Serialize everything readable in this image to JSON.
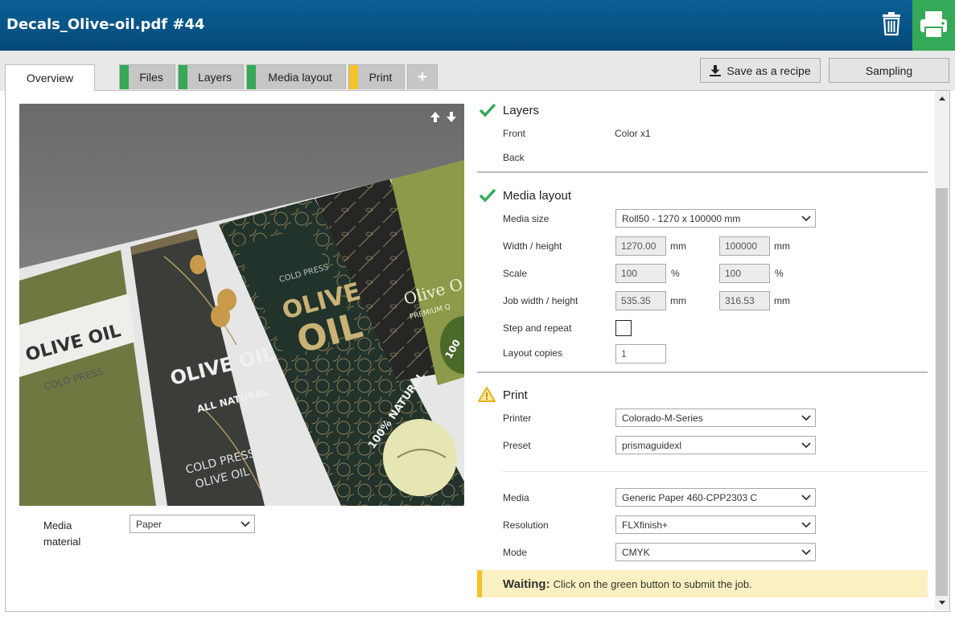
{
  "window": {
    "title": "Decals_Olive-oil.pdf #44"
  },
  "colors": {
    "header": "#0a5f96",
    "print_button": "#35a957",
    "marker_ok": "#35a957",
    "marker_warn": "#f5c228",
    "tab_bg": "#c6c6c6",
    "waiting_bg": "#fbf0c1"
  },
  "tabs": [
    {
      "label": "Overview",
      "status": "active"
    },
    {
      "label": "Files",
      "status": "ok"
    },
    {
      "label": "Layers",
      "status": "ok"
    },
    {
      "label": "Media layout",
      "status": "ok"
    },
    {
      "label": "Print",
      "status": "warning"
    },
    {
      "label": "+",
      "status": "add"
    }
  ],
  "toolbar": {
    "save_recipe": "Save as a recipe",
    "sampling": "Sampling"
  },
  "preview": {
    "texts": {
      "l1_title": "OLIVE OIL",
      "l1_sub": "COLD PRESS",
      "l2_title": "OLIVE OIL",
      "l2_sub": "ALL NATURAL",
      "l2_foot1": "COLD PRESS",
      "l2_foot2": "OLIVE OIL",
      "l3_small": "COLD PRESS",
      "l3_title1": "OLIVE",
      "l3_title2": "OIL",
      "l3_badge": "100% NATURAL",
      "l5_title": "Olive O",
      "l5_sub": "PREMIUM Q",
      "l5_badge": "100"
    }
  },
  "media_material": {
    "label": "Media material",
    "value": "Paper"
  },
  "layers": {
    "title": "Layers",
    "front_label": "Front",
    "front_value": "Color x1",
    "back_label": "Back",
    "back_value": ""
  },
  "media_layout": {
    "title": "Media layout",
    "media_size_label": "Media size",
    "media_size_value": "Roll50 - 1270 x 100000 mm",
    "wh_label": "Width / height",
    "width": "1270.00",
    "height": "100000",
    "wh_unit": "mm",
    "scale_label": "Scale",
    "scale_x": "100",
    "scale_y": "100",
    "scale_unit": "%",
    "job_wh_label": "Job width / height",
    "job_width": "535.35",
    "job_height": "316.53",
    "job_unit": "mm",
    "step_label": "Step and repeat",
    "step_checked": false,
    "copies_label": "Layout copies",
    "copies": "1"
  },
  "print": {
    "title": "Print",
    "printer_label": "Printer",
    "printer_value": "Colorado-M-Series",
    "preset_label": "Preset",
    "preset_value": "prismaguidexl",
    "media_label": "Media",
    "media_value": "Generic Paper 460-CPP2303 C",
    "resolution_label": "Resolution",
    "resolution_value": "FLXfinish+",
    "mode_label": "Mode",
    "mode_value": "CMYK"
  },
  "status": {
    "label": "Waiting:",
    "message": "Click on the green button to submit the job."
  }
}
